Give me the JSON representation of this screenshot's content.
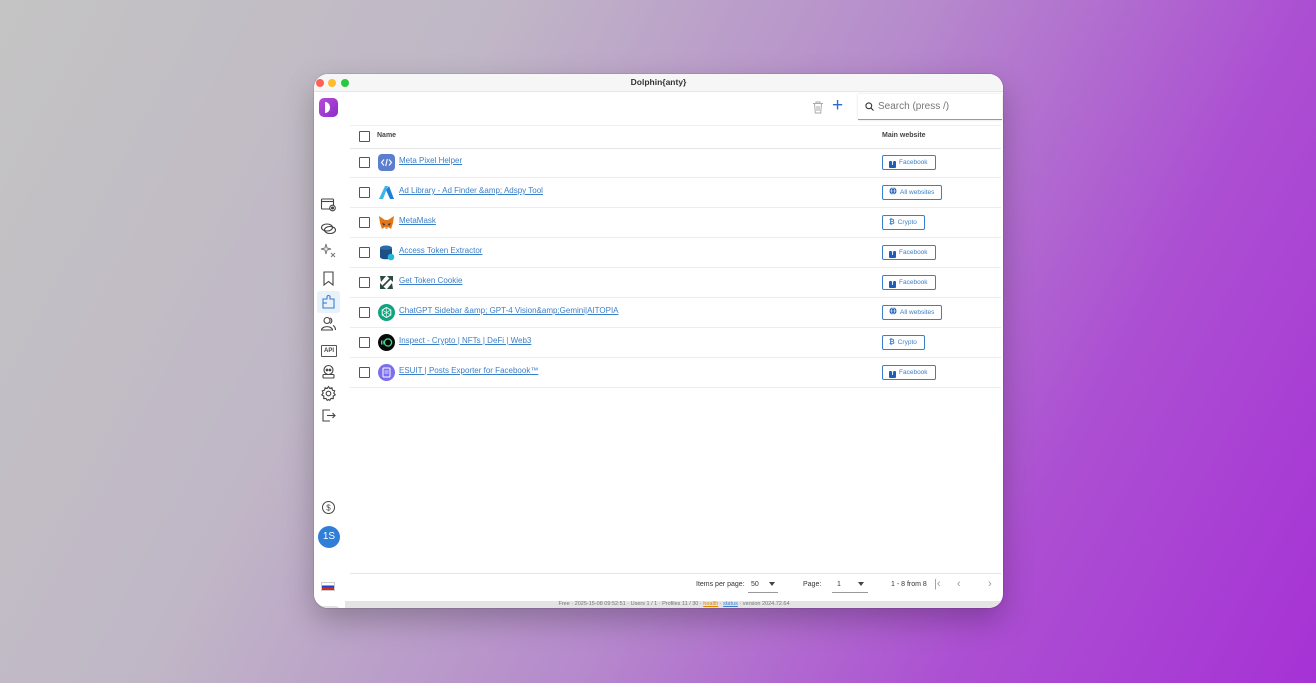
{
  "window": {
    "title": "Dolphin{anty}"
  },
  "toolbar": {
    "search_placeholder": "Search (press /)"
  },
  "table": {
    "col_name": "Name",
    "col_site": "Main website",
    "rows": [
      {
        "name": "Meta Pixel Helper",
        "site": "Facebook",
        "site_icon": "facebook-icon"
      },
      {
        "name": "Ad Library - Ad Finder &amp; Adspy Tool",
        "site": "All websites",
        "site_icon": "globe-icon"
      },
      {
        "name": "MetaMask",
        "site": "Crypto",
        "site_icon": "bitcoin-icon"
      },
      {
        "name": "Access Token Extractor",
        "site": "Facebook",
        "site_icon": "facebook-icon"
      },
      {
        "name": "Get Token Cookie",
        "site": "Facebook",
        "site_icon": "facebook-icon"
      },
      {
        "name": "ChatGPT Sidebar &amp; GPT-4 Vision&amp;Gemini|AITOPIA",
        "site": "All websites",
        "site_icon": "globe-icon"
      },
      {
        "name": "Inspect - Crypto | NFTs | DeFi | Web3",
        "site": "Crypto",
        "site_icon": "bitcoin-icon"
      },
      {
        "name": "ESUIT | Posts Exporter for Facebook™",
        "site": "Facebook",
        "site_icon": "facebook-icon"
      }
    ]
  },
  "pagination": {
    "items_label": "Items per page:",
    "items_value": "50",
    "page_label": "Page:",
    "page_value": "1",
    "range": "1 - 8 from 8"
  },
  "sidebar": {
    "avatar": "1S"
  },
  "statusbar": {
    "pre": "Free · 2025-15-08 09:52:51 · Users 1 / 1 · Profiles 11 / 30 · ",
    "health": "health",
    "sep": " · ",
    "status": "status",
    "version": " · version 2024.72.64"
  },
  "colors": {
    "accent": "#3a7fc9",
    "brand": "#9b3bd3",
    "facebook": "#1d5fb8"
  }
}
